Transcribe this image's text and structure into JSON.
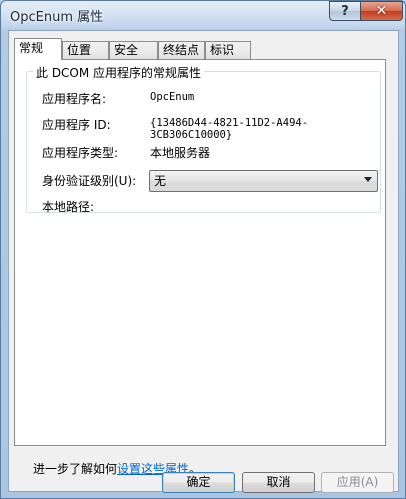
{
  "window": {
    "title": "OpcEnum 属性",
    "help_glyph": "?",
    "close_glyph": "✕"
  },
  "tabs": [
    {
      "label": "常规",
      "active": true
    },
    {
      "label": "位置",
      "active": false
    },
    {
      "label": "安全",
      "active": false
    },
    {
      "label": "终结点",
      "active": false
    },
    {
      "label": "标识",
      "active": false
    }
  ],
  "general": {
    "group_title": "此 DCOM 应用程序的常规属性",
    "app_name_label": "应用程序名:",
    "app_name_value": "OpcEnum",
    "app_id_label": "应用程序 ID:",
    "app_id_value": "{13486D44-4821-11D2-A494-3CB306C10000}",
    "app_type_label": "应用程序类型:",
    "app_type_value": "本地服务器",
    "auth_level_label": "身份验证级别(U):",
    "auth_level_value": "无",
    "local_path_label": "本地路径:",
    "local_path_value": ""
  },
  "footer": {
    "learn_more_prefix": "进一步了解如何",
    "learn_more_link": "设置这些属性",
    "learn_more_suffix": "。"
  },
  "buttons": {
    "ok": "确定",
    "cancel": "取消",
    "apply": "应用(A)"
  }
}
